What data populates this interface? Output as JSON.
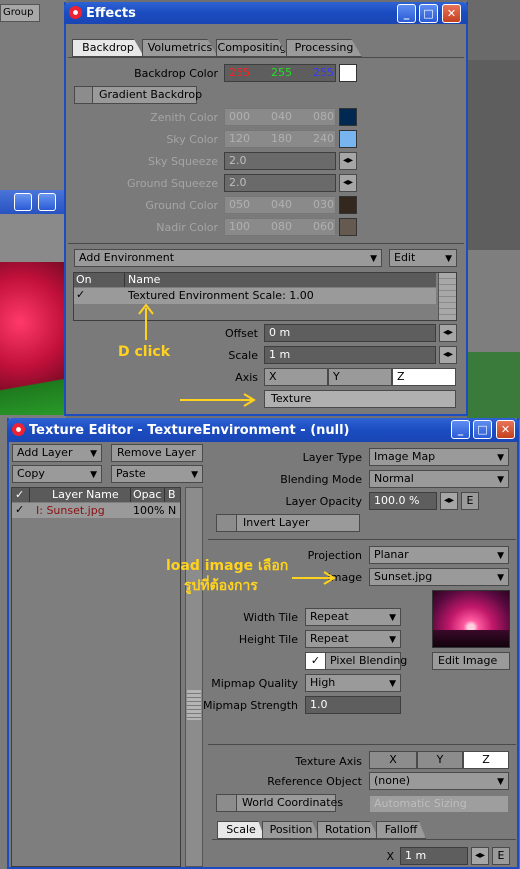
{
  "background": {
    "group_tab": "Group"
  },
  "effects": {
    "title": "Effects",
    "tabs": [
      "Backdrop",
      "Volumetrics",
      "Compositing",
      "Processing"
    ],
    "backdrop_color_label": "Backdrop Color",
    "backdrop_rgb": [
      "255",
      "255",
      "255"
    ],
    "gradient_backdrop": "Gradient Backdrop",
    "zenith_label": "Zenith Color",
    "zenith_rgb": [
      "000",
      "040",
      "080"
    ],
    "sky_label": "Sky Color",
    "sky_rgb": [
      "120",
      "180",
      "240"
    ],
    "sky_squeeze_label": "Sky Squeeze",
    "sky_squeeze": "2.0",
    "ground_squeeze_label": "Ground Squeeze",
    "ground_squeeze": "2.0",
    "ground_label": "Ground Color",
    "ground_rgb": [
      "050",
      "040",
      "030"
    ],
    "nadir_label": "Nadir Color",
    "nadir_rgb": [
      "100",
      "080",
      "060"
    ],
    "add_environment": "Add Environment",
    "edit": "Edit",
    "col_on": "On",
    "col_name": "Name",
    "env_row": "Textured Environment Scale: 1.00",
    "offset_label": "Offset",
    "offset": "0 m",
    "scale_label": "Scale",
    "scale": "1 m",
    "axis_label": "Axis",
    "axis": [
      "X",
      "Y",
      "Z"
    ],
    "texture": "Texture",
    "colors": {
      "zenith": "#002850",
      "sky": "#78b4f0",
      "ground": "#32281e",
      "nadir": "#645a50"
    }
  },
  "annotations": {
    "dclick": "D click",
    "load_image_1": "load image เลือก",
    "load_image_2": "รูปที่ต้องการ"
  },
  "texture_editor": {
    "title": "Texture Editor - TextureEnvironment - (null)",
    "add_layer": "Add Layer",
    "remove_layer": "Remove Layer",
    "copy": "Copy",
    "paste": "Paste",
    "col_layer_name": "Layer Name",
    "col_opac": "Opac",
    "col_b": "B",
    "layer_row": {
      "name": "I: Sunset.jpg",
      "opac": "100%",
      "b": "N"
    },
    "layer_type_label": "Layer Type",
    "layer_type": "Image Map",
    "blending_mode_label": "Blending Mode",
    "blending_mode": "Normal",
    "layer_opacity_label": "Layer Opacity",
    "layer_opacity": "100.0 %",
    "env_btn": "E",
    "invert_layer": "Invert Layer",
    "projection_label": "Projection",
    "projection": "Planar",
    "image_label": "Image",
    "image": "Sunset.jpg",
    "width_tile_label": "Width Tile",
    "width_tile": "Repeat",
    "height_tile_label": "Height Tile",
    "height_tile": "Repeat",
    "pixel_blending": "Pixel Blending",
    "edit_image": "Edit Image",
    "mipmap_quality_label": "Mipmap Quality",
    "mipmap_quality": "High",
    "mipmap_strength_label": "Mipmap Strength",
    "mipmap_strength": "1.0",
    "texture_axis_label": "Texture Axis",
    "texture_axis": [
      "X",
      "Y",
      "Z"
    ],
    "reference_object_label": "Reference Object",
    "reference_object": "(none)",
    "world_coordinates": "World Coordinates",
    "automatic_sizing": "Automatic Sizing",
    "bottom_tabs": [
      "Scale",
      "Position",
      "Rotation",
      "Falloff"
    ],
    "x_label": "X",
    "x_value": "1 m"
  }
}
